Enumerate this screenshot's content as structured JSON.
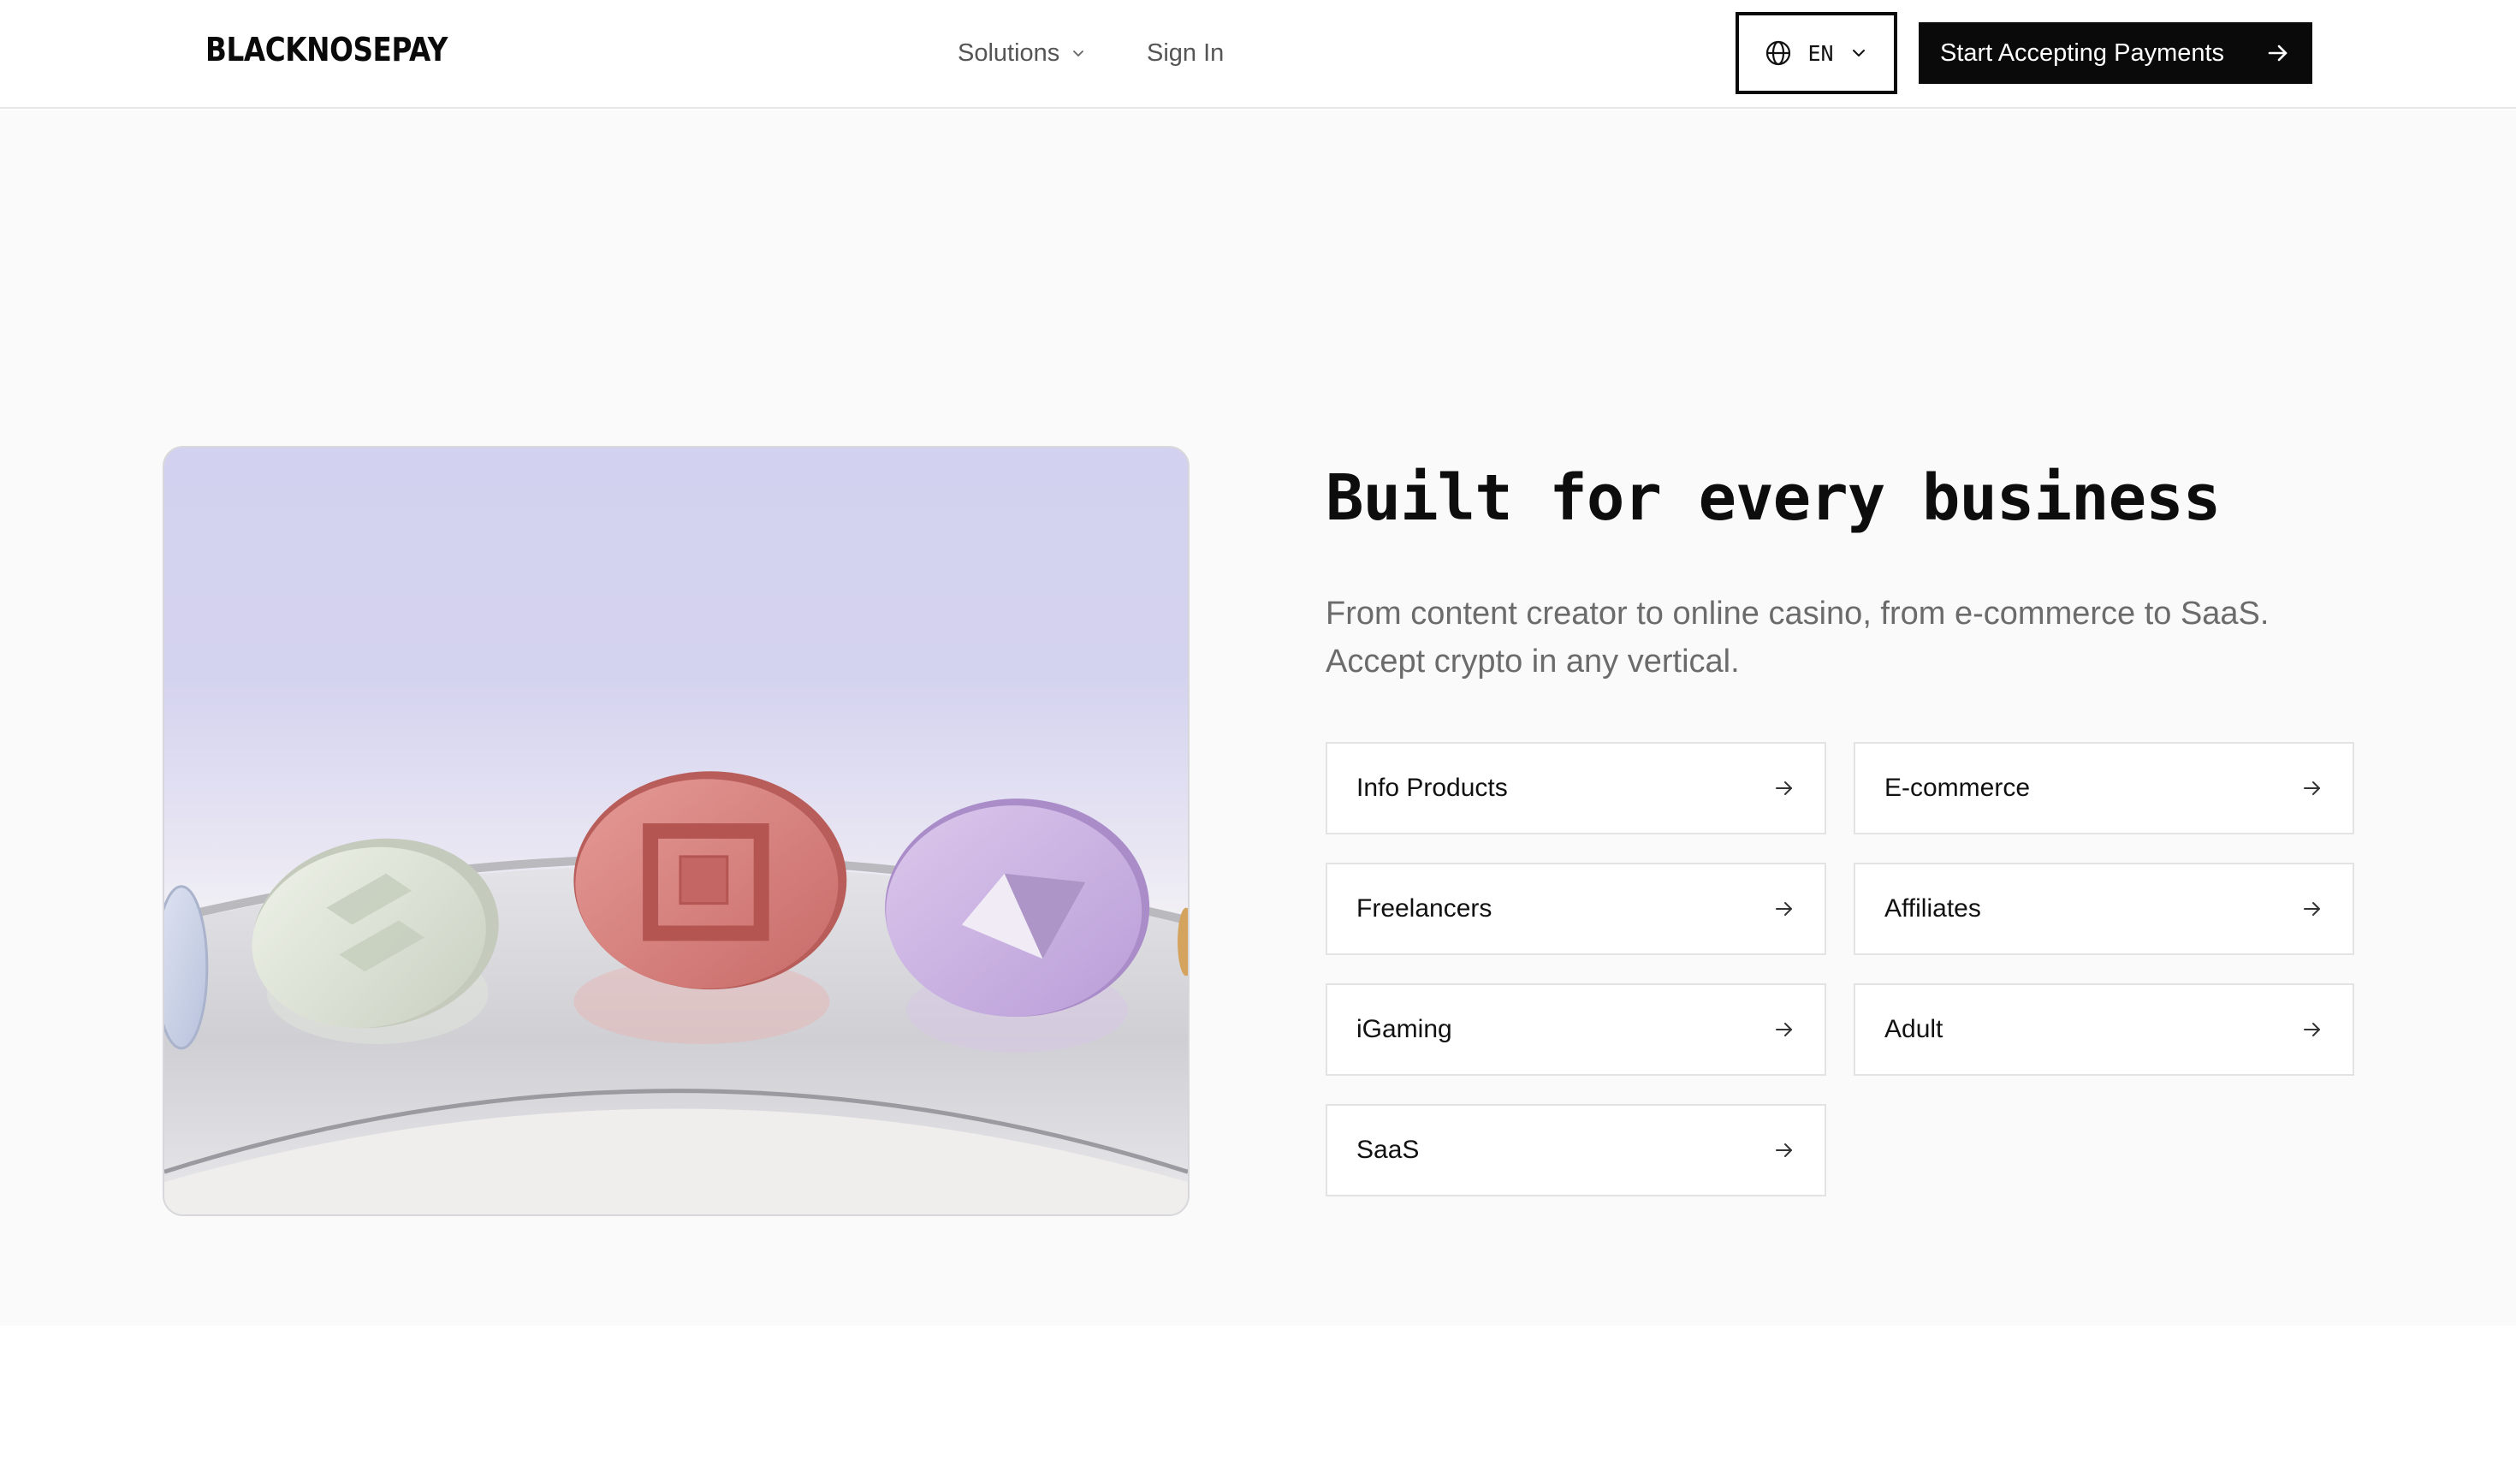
{
  "header": {
    "logo": "BLACKNOSEPAY",
    "nav": {
      "solutions": "Solutions",
      "sign_in": "Sign In"
    },
    "language": {
      "icon": "globe-icon",
      "code": "EN"
    },
    "cta": {
      "label": "Start Accepting Payments",
      "icon": "arrow-right-icon"
    }
  },
  "hero": {
    "image": {
      "alt_description": ""
    },
    "title": "Built for every business",
    "subtitle_line1": "From content creator to online casino, from e-commerce to SaaS.",
    "subtitle_line2": "Accept crypto in any vertical.",
    "verticals": [
      {
        "label": "Info Products"
      },
      {
        "label": "E-commerce"
      },
      {
        "label": "Freelancers"
      },
      {
        "label": "Affiliates"
      },
      {
        "label": "iGaming"
      },
      {
        "label": "Adult"
      },
      {
        "label": "SaaS"
      }
    ]
  },
  "colors": {
    "primary": "#0a0a0a",
    "section_bg": "#fafafa",
    "muted_text": "#6b6b6b",
    "tile_border": "#e3e3e3"
  }
}
